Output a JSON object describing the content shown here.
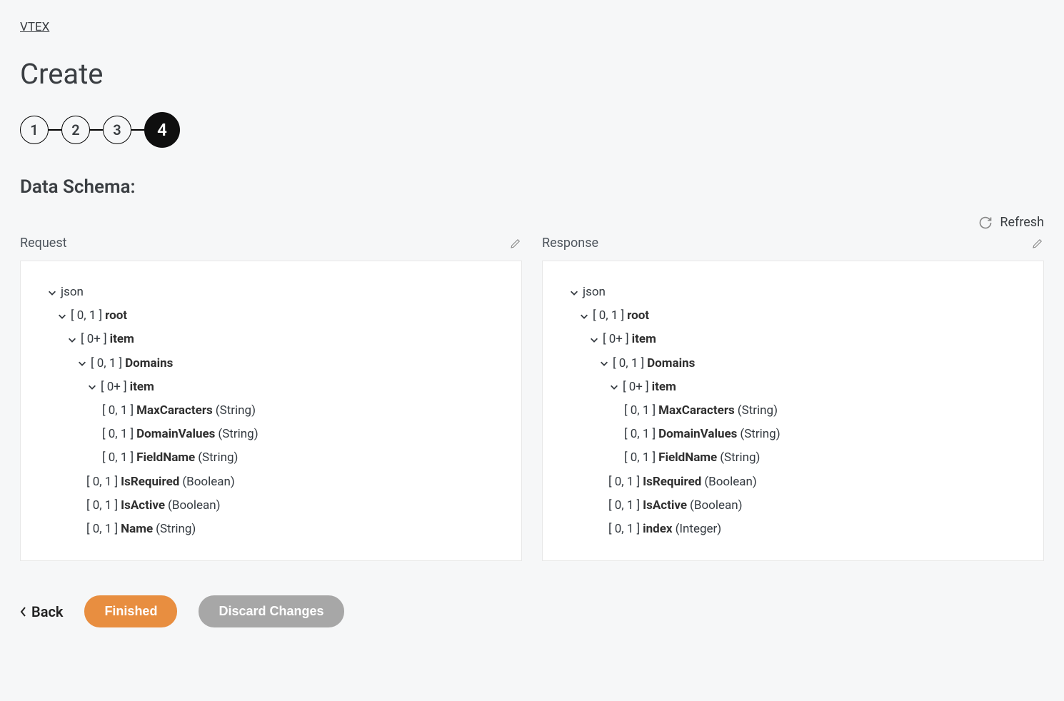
{
  "breadcrumb": "VTEX",
  "page_title": "Create",
  "stepper": {
    "steps": [
      "1",
      "2",
      "3",
      "4"
    ],
    "active_index": 3
  },
  "section_title": "Data Schema:",
  "refresh_label": "Refresh",
  "request": {
    "label": "Request",
    "tree": {
      "root_label": "json",
      "nodes": [
        {
          "indent": 1,
          "chev": true,
          "card": "[ 0, 1 ]",
          "name": "root",
          "type": ""
        },
        {
          "indent": 2,
          "chev": true,
          "card": "[ 0+ ]",
          "name": "item",
          "type": ""
        },
        {
          "indent": 3,
          "chev": true,
          "card": "[ 0, 1 ]",
          "name": "Domains",
          "type": ""
        },
        {
          "indent": 4,
          "chev": true,
          "card": "[ 0+ ]",
          "name": "item",
          "type": ""
        },
        {
          "indent": 5,
          "chev": false,
          "card": "[ 0, 1 ]",
          "name": "MaxCaracters",
          "type": "(String)"
        },
        {
          "indent": 5,
          "chev": false,
          "card": "[ 0, 1 ]",
          "name": "DomainValues",
          "type": "(String)"
        },
        {
          "indent": 5,
          "chev": false,
          "card": "[ 0, 1 ]",
          "name": "FieldName",
          "type": "(String)"
        },
        {
          "indent": 4,
          "chev": false,
          "card": "[ 0, 1 ]",
          "name": "IsRequired",
          "type": "(Boolean)"
        },
        {
          "indent": 4,
          "chev": false,
          "card": "[ 0, 1 ]",
          "name": "IsActive",
          "type": "(Boolean)"
        },
        {
          "indent": 4,
          "chev": false,
          "card": "[ 0, 1 ]",
          "name": "Name",
          "type": "(String)"
        }
      ]
    }
  },
  "response": {
    "label": "Response",
    "tree": {
      "root_label": "json",
      "nodes": [
        {
          "indent": 1,
          "chev": true,
          "card": "[ 0, 1 ]",
          "name": "root",
          "type": ""
        },
        {
          "indent": 2,
          "chev": true,
          "card": "[ 0+ ]",
          "name": "item",
          "type": ""
        },
        {
          "indent": 3,
          "chev": true,
          "card": "[ 0, 1 ]",
          "name": "Domains",
          "type": ""
        },
        {
          "indent": 4,
          "chev": true,
          "card": "[ 0+ ]",
          "name": "item",
          "type": ""
        },
        {
          "indent": 5,
          "chev": false,
          "card": "[ 0, 1 ]",
          "name": "MaxCaracters",
          "type": "(String)"
        },
        {
          "indent": 5,
          "chev": false,
          "card": "[ 0, 1 ]",
          "name": "DomainValues",
          "type": "(String)"
        },
        {
          "indent": 5,
          "chev": false,
          "card": "[ 0, 1 ]",
          "name": "FieldName",
          "type": "(String)"
        },
        {
          "indent": 4,
          "chev": false,
          "card": "[ 0, 1 ]",
          "name": "IsRequired",
          "type": "(Boolean)"
        },
        {
          "indent": 4,
          "chev": false,
          "card": "[ 0, 1 ]",
          "name": "IsActive",
          "type": "(Boolean)"
        },
        {
          "indent": 4,
          "chev": false,
          "card": "[ 0, 1 ]",
          "name": "index",
          "type": "(Integer)"
        }
      ]
    }
  },
  "footer": {
    "back": "Back",
    "finished": "Finished",
    "discard": "Discard Changes"
  }
}
